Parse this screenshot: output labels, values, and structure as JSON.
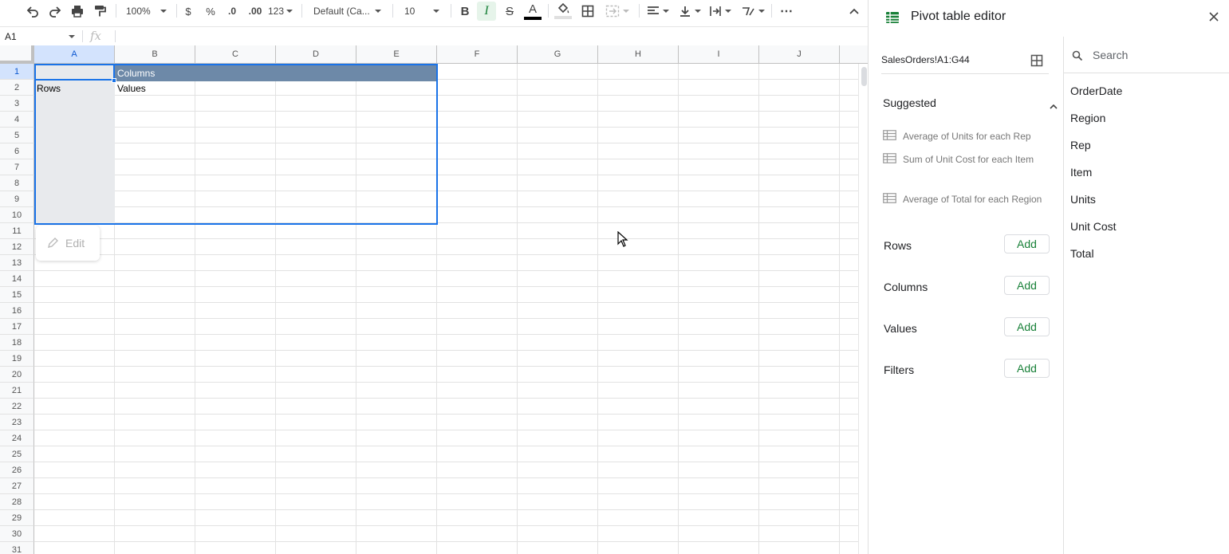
{
  "toolbar": {
    "zoom": "100%",
    "currency": "$",
    "percent": "%",
    "dec_decrease": ".0",
    "dec_increase": ".00",
    "more_formats": "123",
    "font_family": "Default (Ca...",
    "font_size": "10",
    "bold": "B",
    "italic": "I",
    "strike": "S",
    "text_color_letter": "A",
    "more": "⋯"
  },
  "formula_bar": {
    "name_box": "A1",
    "fx": "fx",
    "value": ""
  },
  "grid": {
    "columns": [
      "A",
      "B",
      "C",
      "D",
      "E",
      "F",
      "G",
      "H",
      "I",
      "J"
    ],
    "rows": [
      "1",
      "2",
      "3",
      "4",
      "5",
      "6",
      "7",
      "8",
      "9",
      "10",
      "11",
      "12",
      "13",
      "14",
      "15",
      "16",
      "17",
      "18",
      "19",
      "20",
      "21",
      "22",
      "23",
      "24",
      "25",
      "26",
      "27",
      "28",
      "29",
      "30",
      "31"
    ],
    "cells": {
      "B1": "Columns",
      "A2": "Rows",
      "B2": "Values"
    },
    "edit_label": "Edit"
  },
  "panel": {
    "title": "Pivot table editor",
    "range": "SalesOrders!A1:G44",
    "suggested_label": "Suggested",
    "suggestions": [
      "Average of Units for each Rep",
      "Sum of Unit Cost for each Item",
      "Average of Total for each Region"
    ],
    "sections": [
      {
        "label": "Rows",
        "button": "Add"
      },
      {
        "label": "Columns",
        "button": "Add"
      },
      {
        "label": "Values",
        "button": "Add"
      },
      {
        "label": "Filters",
        "button": "Add"
      }
    ],
    "search_placeholder": "Search",
    "fields": [
      "OrderDate",
      "Region",
      "Rep",
      "Item",
      "Units",
      "Unit Cost",
      "Total"
    ]
  },
  "colors": {
    "accent": "#1a73e8",
    "pivot_header_band": "#6d89a8",
    "add_text": "#188038",
    "sheets_green": "#188038"
  }
}
